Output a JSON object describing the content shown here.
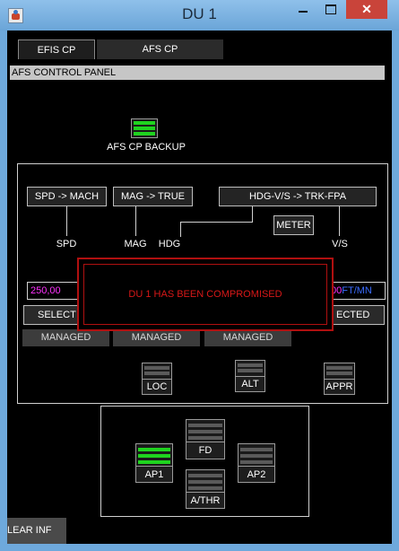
{
  "window": {
    "title": "DU 1",
    "close_glyph": "✕"
  },
  "tabs": [
    {
      "label": "EFIS CP",
      "active": true
    },
    {
      "label": "AFS CP",
      "active": false
    }
  ],
  "panel_header": "AFS CONTROL PANEL",
  "backup": {
    "label": "AFS CP BACKUP",
    "on": true
  },
  "conversions": {
    "spd_mach": "SPD -> MACH",
    "mag_true": "MAG ->  TRUE",
    "hdg_trk": "HDG-V/S -> TRK-FPA",
    "meter": "METER"
  },
  "labels": {
    "spd": "SPD",
    "mag": "MAG",
    "hdg": "HDG",
    "vs": "V/S"
  },
  "fields": {
    "speed_value": "250,00",
    "vs_value": "00",
    "vs_unit": "FT/MN"
  },
  "selected": {
    "left": "SELECT",
    "right": "ECTED"
  },
  "managed": [
    "MANAGED",
    "MANAGED",
    "MANAGED"
  ],
  "modes": {
    "loc": "LOC",
    "alt": "ALT",
    "appr": "APPR"
  },
  "autopilot": {
    "fd": {
      "label": "FD",
      "on": false
    },
    "ap1": {
      "label": "AP1",
      "on": true
    },
    "ap2": {
      "label": "AP2",
      "on": false
    },
    "athr": {
      "label": "A/THR",
      "on": false
    }
  },
  "alert": "DU 1 HAS BEEN COMPROMISED",
  "clear_info": "LEAR INF",
  "colors": {
    "lamp_on": "#1fd31f",
    "alert": "#d81818",
    "speed": "#ff33ff",
    "unit": "#3b6cff"
  }
}
